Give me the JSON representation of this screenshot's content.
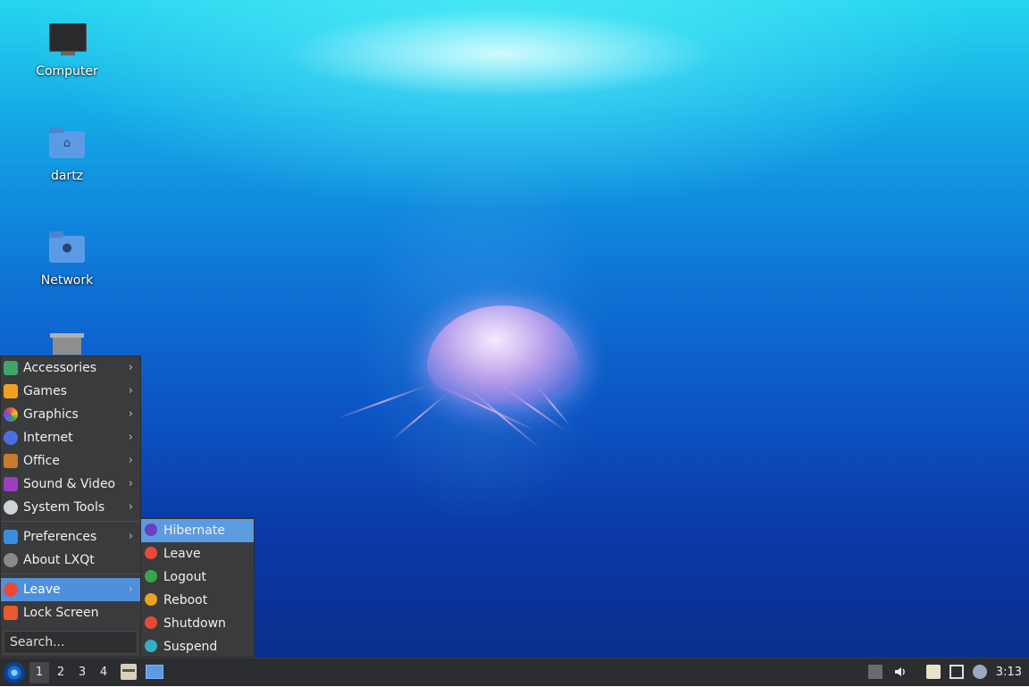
{
  "desktop": {
    "icons": [
      {
        "label": "Computer",
        "icon": "computer-icon"
      },
      {
        "label": "dartz",
        "icon": "home-folder-icon"
      },
      {
        "label": "Network",
        "icon": "network-folder-icon"
      },
      {
        "label": "",
        "icon": "trash-icon"
      }
    ]
  },
  "menu": {
    "items": [
      {
        "label": "Accessories",
        "icon": "accessories-icon",
        "color": "#3fa66a",
        "submenu": true
      },
      {
        "label": "Games",
        "icon": "games-icon",
        "color": "#f0a020",
        "submenu": true
      },
      {
        "label": "Graphics",
        "icon": "graphics-icon",
        "color": "#e8503a",
        "submenu": true
      },
      {
        "label": "Internet",
        "icon": "internet-icon",
        "color": "#4a6fe0",
        "submenu": true
      },
      {
        "label": "Office",
        "icon": "office-icon",
        "color": "#c97a2a",
        "submenu": true
      },
      {
        "label": "Sound & Video",
        "icon": "sound-video-icon",
        "color": "#9a3fc0",
        "submenu": true
      },
      {
        "label": "System Tools",
        "icon": "system-tools-icon",
        "color": "#cfd3d8",
        "submenu": true
      },
      {
        "label": "Preferences",
        "icon": "preferences-icon",
        "color": "#3a8ee0",
        "submenu": true
      },
      {
        "label": "About LXQt",
        "icon": "info-icon",
        "color": "#8a8a8a",
        "submenu": false
      },
      {
        "label": "Leave",
        "icon": "power-icon",
        "color": "#e84a3a",
        "submenu": true,
        "selected": true
      },
      {
        "label": "Lock Screen",
        "icon": "lock-icon",
        "color": "#e85a30",
        "submenu": false
      }
    ],
    "search_placeholder": "Search..."
  },
  "leave_submenu": {
    "items": [
      {
        "label": "Hibernate",
        "icon": "hibernate-icon",
        "color": "#6a3fc0",
        "selected": true
      },
      {
        "label": "Leave",
        "icon": "power-icon",
        "color": "#e84a3a"
      },
      {
        "label": "Logout",
        "icon": "logout-icon",
        "color": "#3aa64a"
      },
      {
        "label": "Reboot",
        "icon": "reboot-icon",
        "color": "#f0a020"
      },
      {
        "label": "Shutdown",
        "icon": "shutdown-icon",
        "color": "#e84a3a"
      },
      {
        "label": "Suspend",
        "icon": "suspend-icon",
        "color": "#30b0c8"
      }
    ]
  },
  "taskbar": {
    "workspaces": [
      "1",
      "2",
      "3",
      "4"
    ],
    "active_workspace": "1",
    "clock": "3:13"
  }
}
